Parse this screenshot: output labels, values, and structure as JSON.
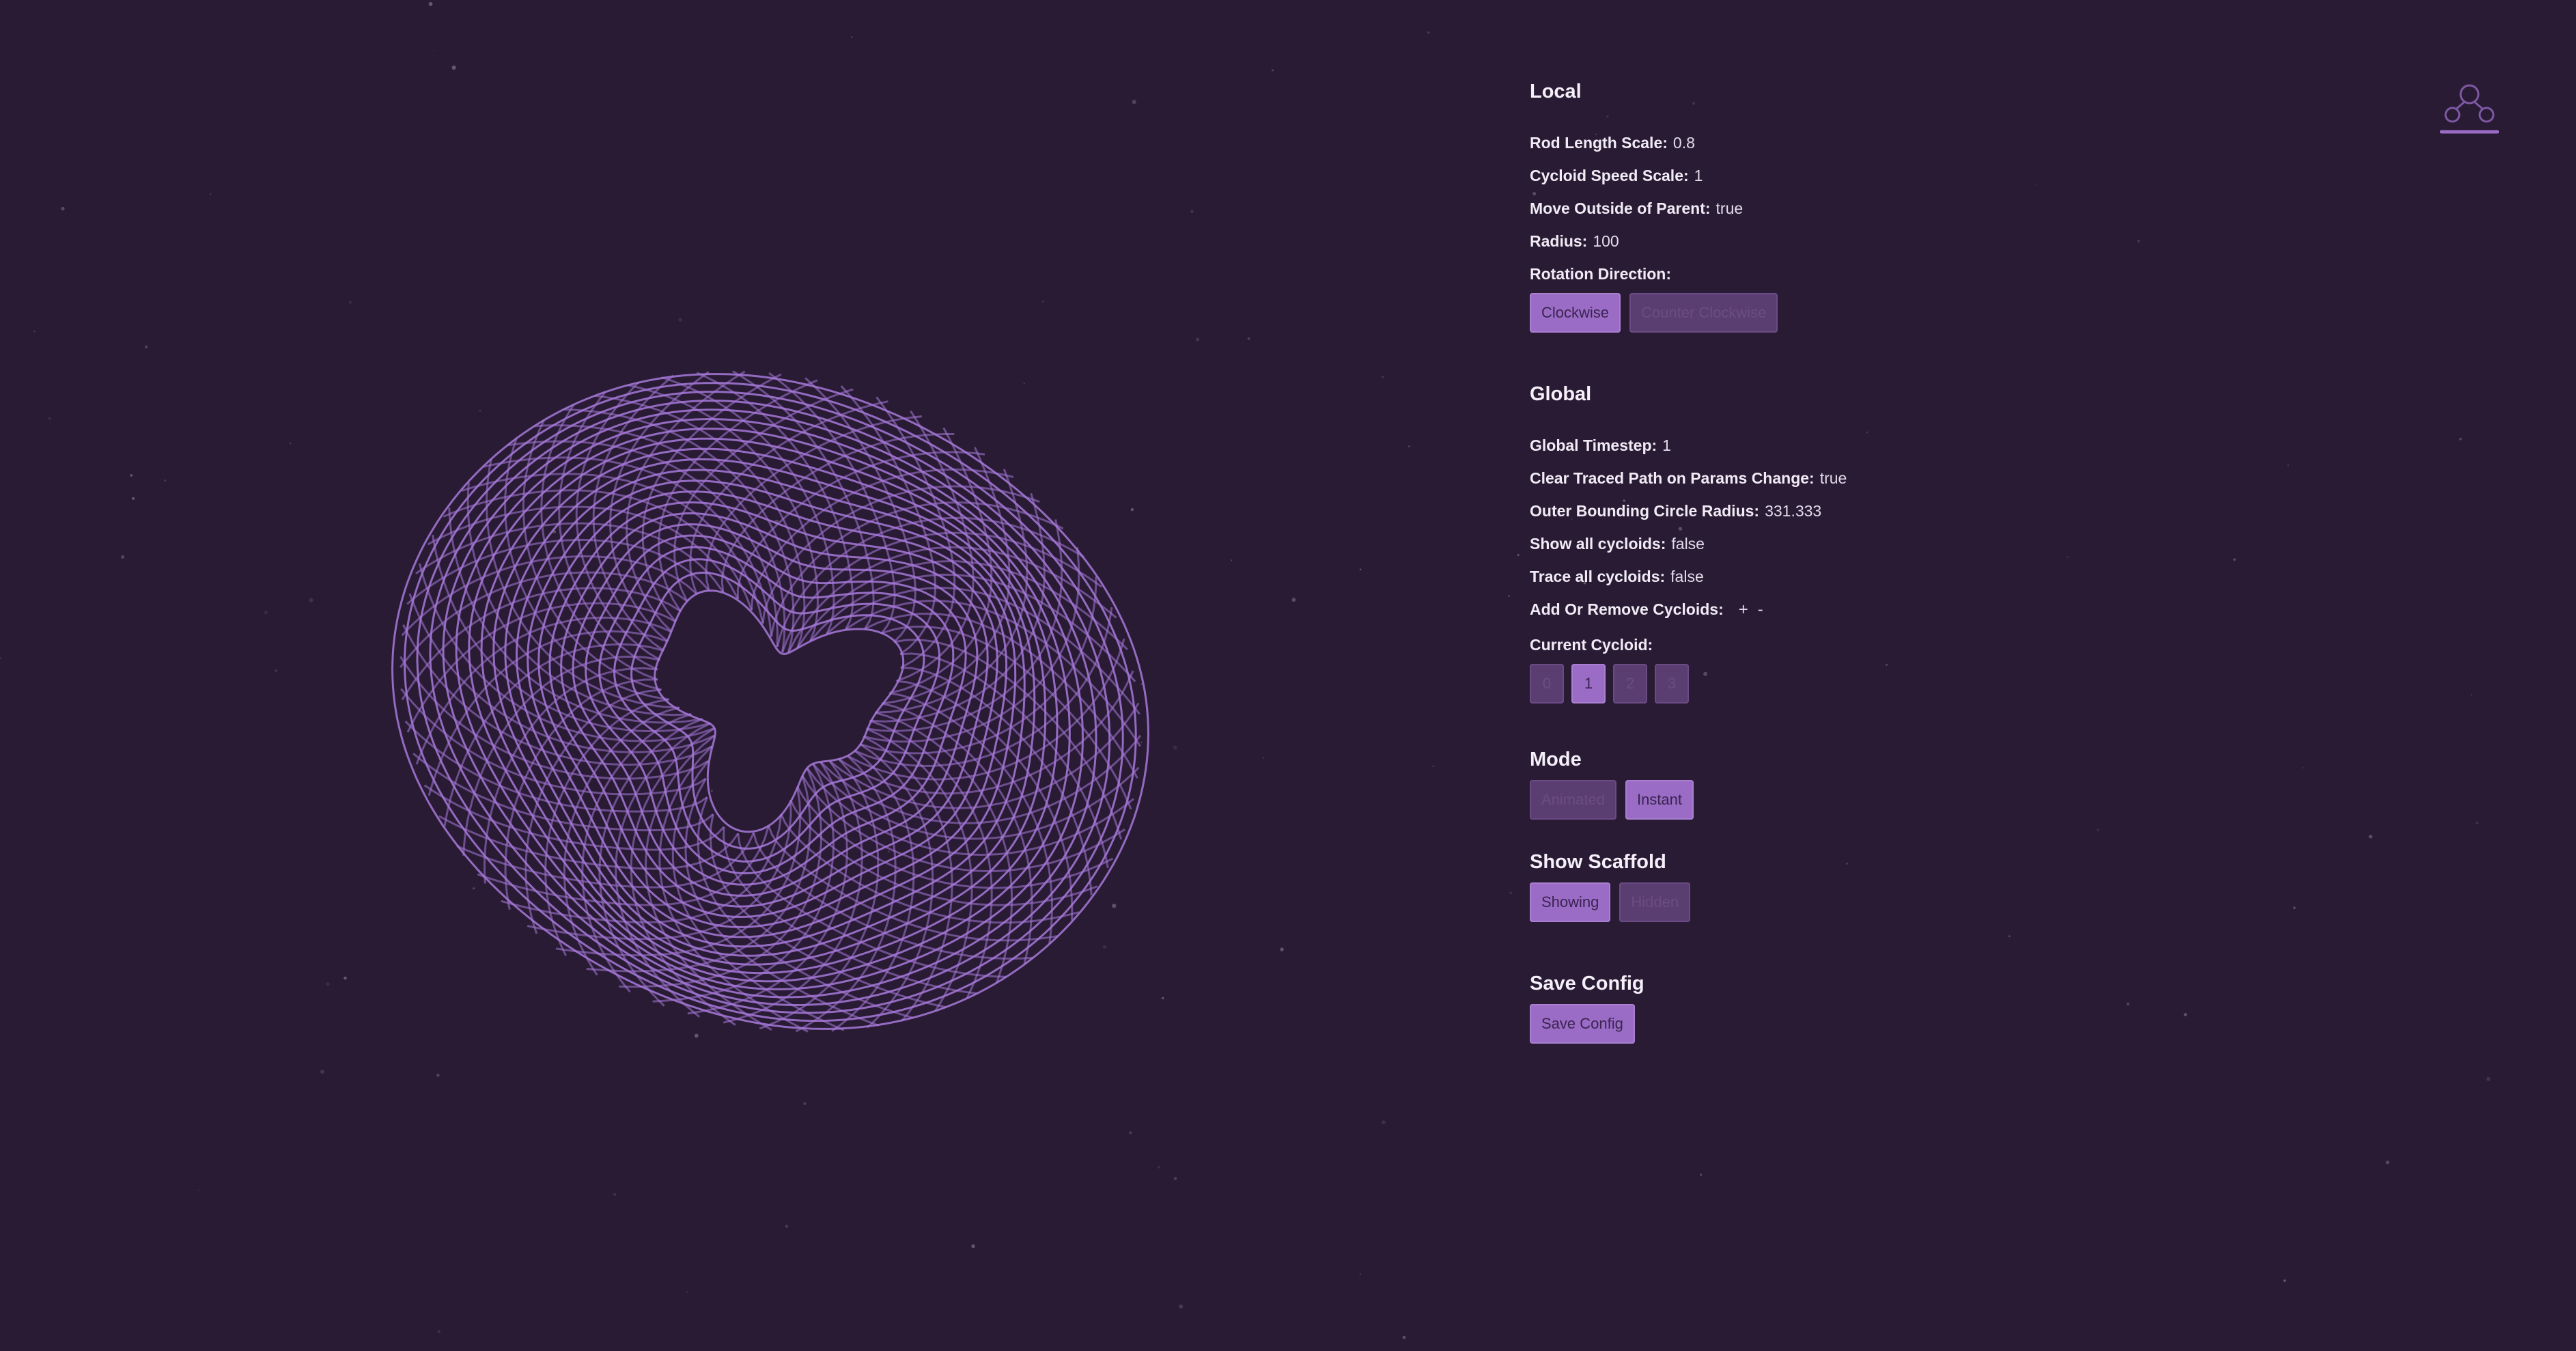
{
  "local": {
    "title": "Local",
    "rod_length_scale": {
      "label": "Rod Length Scale:",
      "value": "0.8"
    },
    "cycloid_speed_scale": {
      "label": "Cycloid Speed Scale:",
      "value": "1"
    },
    "move_outside_parent": {
      "label": "Move Outside of Parent:",
      "value": "true"
    },
    "radius": {
      "label": "Radius:",
      "value": "100"
    },
    "rotation_direction": {
      "label": "Rotation Direction:",
      "options": [
        "Clockwise",
        "Counter Clockwise"
      ],
      "selected": "Clockwise"
    }
  },
  "global": {
    "title": "Global",
    "global_timestep": {
      "label": "Global Timestep:",
      "value": "1"
    },
    "clear_traced_path": {
      "label": "Clear Traced Path on Params Change:",
      "value": "true"
    },
    "outer_bounding_radius": {
      "label": "Outer Bounding Circle Radius:",
      "value": "331.333"
    },
    "show_all_cycloids": {
      "label": "Show all cycloids:",
      "value": "false"
    },
    "trace_all_cycloids": {
      "label": "Trace all cycloids:",
      "value": "false"
    },
    "add_remove_cycloids": {
      "label": "Add Or Remove Cycloids:",
      "add": "+",
      "remove": "-"
    },
    "current_cycloid": {
      "label": "Current Cycloid:",
      "options": [
        "0",
        "1",
        "2",
        "3"
      ],
      "selected": "1"
    }
  },
  "mode": {
    "title": "Mode",
    "options": [
      "Animated",
      "Instant"
    ],
    "selected": "Instant"
  },
  "scaffold": {
    "title": "Show Scaffold",
    "options": [
      "Showing",
      "Hidden"
    ],
    "selected": "Showing"
  },
  "save": {
    "title": "Save Config",
    "button": "Save Config"
  },
  "icons": {
    "logo": "graph-nodes-icon"
  },
  "colors": {
    "background": "#291b33",
    "accent": "#9a6cc6",
    "curve": "#a679d9",
    "button_inactive": "#5a3d71"
  }
}
